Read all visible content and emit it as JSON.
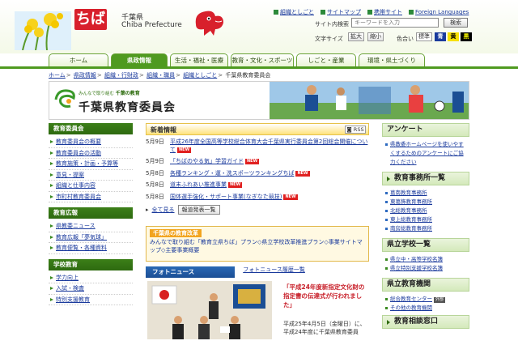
{
  "header": {
    "logo_text": "ちば",
    "prefecture_ja": "千葉県",
    "prefecture_en": "Chiba Prefecture",
    "top_links": [
      "組織としごと",
      "サイトマップ",
      "携帯サイト",
      "Foreign Languages"
    ],
    "search_label": "サイト内検索",
    "search_placeholder": "キーワードを入力",
    "search_button": "検索",
    "text_size_label": "文字サイズ",
    "size_buttons": [
      "拡大",
      "縮小"
    ],
    "color_label": "色合い",
    "color_buttons": [
      "標準",
      "青",
      "黄",
      "黒"
    ]
  },
  "nav": {
    "tabs": [
      "ホーム",
      "県政情報",
      "生活・福祉・医療",
      "教育・文化・スポーツ",
      "しごと・産業",
      "環境・県土づくり"
    ]
  },
  "breadcrumb": [
    "ホーム",
    "県政情報",
    "組織・行財政",
    "組織・職員",
    "組織としごと",
    "千葉県教育委員会"
  ],
  "banner": {
    "tagline_prefix": "みんなで取り組む",
    "tagline_strong": "千葉の教育",
    "title": "千葉県教育委員会"
  },
  "left_sections": [
    {
      "title": "教育委員会",
      "items": [
        "教育委員会の概要",
        "教育委員会の活動",
        "教育施策・計画・予算等",
        "意見・提案",
        "組織と仕事内容",
        "市町村教育委員会"
      ]
    },
    {
      "title": "教育広報",
      "items": [
        "県教委ニュース",
        "教育広報「夢気球」",
        "教育便覧・各種資料"
      ]
    },
    {
      "title": "学校教育",
      "items": [
        "学力向上",
        "入試・検査",
        "特別支援教育"
      ]
    }
  ],
  "news": {
    "title": "新着情報",
    "rss_label": "RSS",
    "new_badge": "NEW",
    "items": [
      {
        "date": "5月9日",
        "text": "平成26年度全国高等学校総合体育大会千葉県実行委員会第2回総会開催について",
        "is_new": true
      },
      {
        "date": "5月9日",
        "text": "「ちばのやる気」学習ガイド",
        "is_new": true
      },
      {
        "date": "5月8日",
        "text": "各種ランキング・運・洗スポーツランキングちば",
        "is_new": true
      },
      {
        "date": "5月8日",
        "text": "道末ふれあい推進事業",
        "is_new": true
      },
      {
        "date": "5月8日",
        "text": "国体選手強化・サポート事業(なぎなた競技)",
        "is_new": true
      }
    ],
    "see_all": "全て見る",
    "press_button": "報道発表一覧"
  },
  "reform": {
    "title": "千葉県の教育改革",
    "body": "みんなで取り組む「教育立県ちば」プラン◇県立学校改革推進プラン◇事業サイトマップ◇主要事業概要"
  },
  "photo_news": {
    "title": "フォトニュース",
    "archive_link": "フォトニュース履歴一覧",
    "caption": "「平成24年度新指定文化財の指定書の伝達式が行われました」",
    "text": "平成25年4月5日（金曜日）に、平成24年度に千葉県教育委員"
  },
  "right": {
    "survey_title": "アンケート",
    "survey_items": [
      "県教委ホームページを使いやすくするためのアンケートにご協力ください"
    ],
    "offices_title": "教育事務所一覧",
    "offices": [
      "葛南教育事務所",
      "東葛飾教育事務所",
      "北総教育事務所",
      "東上総教育事務所",
      "南房総教育事務所"
    ],
    "schools_title": "県立学校一覧",
    "schools": [
      "県立中・高等学校名簿",
      "県立特別支援学校名簿"
    ],
    "institutions_title": "県立教育機関",
    "institutions": [
      "総合教育センター",
      "その他の教育機関"
    ],
    "external_badge": "外部",
    "consult_title": "教育相談窓口"
  }
}
